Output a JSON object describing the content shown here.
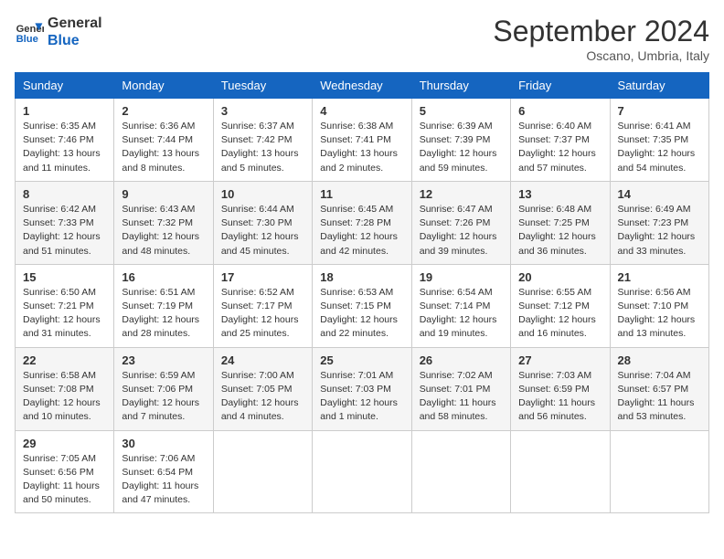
{
  "header": {
    "logo_line1": "General",
    "logo_line2": "Blue",
    "month_title": "September 2024",
    "subtitle": "Oscano, Umbria, Italy"
  },
  "days_of_week": [
    "Sunday",
    "Monday",
    "Tuesday",
    "Wednesday",
    "Thursday",
    "Friday",
    "Saturday"
  ],
  "weeks": [
    [
      {
        "day": "1",
        "sunrise": "Sunrise: 6:35 AM",
        "sunset": "Sunset: 7:46 PM",
        "daylight": "Daylight: 13 hours and 11 minutes."
      },
      {
        "day": "2",
        "sunrise": "Sunrise: 6:36 AM",
        "sunset": "Sunset: 7:44 PM",
        "daylight": "Daylight: 13 hours and 8 minutes."
      },
      {
        "day": "3",
        "sunrise": "Sunrise: 6:37 AM",
        "sunset": "Sunset: 7:42 PM",
        "daylight": "Daylight: 13 hours and 5 minutes."
      },
      {
        "day": "4",
        "sunrise": "Sunrise: 6:38 AM",
        "sunset": "Sunset: 7:41 PM",
        "daylight": "Daylight: 13 hours and 2 minutes."
      },
      {
        "day": "5",
        "sunrise": "Sunrise: 6:39 AM",
        "sunset": "Sunset: 7:39 PM",
        "daylight": "Daylight: 12 hours and 59 minutes."
      },
      {
        "day": "6",
        "sunrise": "Sunrise: 6:40 AM",
        "sunset": "Sunset: 7:37 PM",
        "daylight": "Daylight: 12 hours and 57 minutes."
      },
      {
        "day": "7",
        "sunrise": "Sunrise: 6:41 AM",
        "sunset": "Sunset: 7:35 PM",
        "daylight": "Daylight: 12 hours and 54 minutes."
      }
    ],
    [
      {
        "day": "8",
        "sunrise": "Sunrise: 6:42 AM",
        "sunset": "Sunset: 7:33 PM",
        "daylight": "Daylight: 12 hours and 51 minutes."
      },
      {
        "day": "9",
        "sunrise": "Sunrise: 6:43 AM",
        "sunset": "Sunset: 7:32 PM",
        "daylight": "Daylight: 12 hours and 48 minutes."
      },
      {
        "day": "10",
        "sunrise": "Sunrise: 6:44 AM",
        "sunset": "Sunset: 7:30 PM",
        "daylight": "Daylight: 12 hours and 45 minutes."
      },
      {
        "day": "11",
        "sunrise": "Sunrise: 6:45 AM",
        "sunset": "Sunset: 7:28 PM",
        "daylight": "Daylight: 12 hours and 42 minutes."
      },
      {
        "day": "12",
        "sunrise": "Sunrise: 6:47 AM",
        "sunset": "Sunset: 7:26 PM",
        "daylight": "Daylight: 12 hours and 39 minutes."
      },
      {
        "day": "13",
        "sunrise": "Sunrise: 6:48 AM",
        "sunset": "Sunset: 7:25 PM",
        "daylight": "Daylight: 12 hours and 36 minutes."
      },
      {
        "day": "14",
        "sunrise": "Sunrise: 6:49 AM",
        "sunset": "Sunset: 7:23 PM",
        "daylight": "Daylight: 12 hours and 33 minutes."
      }
    ],
    [
      {
        "day": "15",
        "sunrise": "Sunrise: 6:50 AM",
        "sunset": "Sunset: 7:21 PM",
        "daylight": "Daylight: 12 hours and 31 minutes."
      },
      {
        "day": "16",
        "sunrise": "Sunrise: 6:51 AM",
        "sunset": "Sunset: 7:19 PM",
        "daylight": "Daylight: 12 hours and 28 minutes."
      },
      {
        "day": "17",
        "sunrise": "Sunrise: 6:52 AM",
        "sunset": "Sunset: 7:17 PM",
        "daylight": "Daylight: 12 hours and 25 minutes."
      },
      {
        "day": "18",
        "sunrise": "Sunrise: 6:53 AM",
        "sunset": "Sunset: 7:15 PM",
        "daylight": "Daylight: 12 hours and 22 minutes."
      },
      {
        "day": "19",
        "sunrise": "Sunrise: 6:54 AM",
        "sunset": "Sunset: 7:14 PM",
        "daylight": "Daylight: 12 hours and 19 minutes."
      },
      {
        "day": "20",
        "sunrise": "Sunrise: 6:55 AM",
        "sunset": "Sunset: 7:12 PM",
        "daylight": "Daylight: 12 hours and 16 minutes."
      },
      {
        "day": "21",
        "sunrise": "Sunrise: 6:56 AM",
        "sunset": "Sunset: 7:10 PM",
        "daylight": "Daylight: 12 hours and 13 minutes."
      }
    ],
    [
      {
        "day": "22",
        "sunrise": "Sunrise: 6:58 AM",
        "sunset": "Sunset: 7:08 PM",
        "daylight": "Daylight: 12 hours and 10 minutes."
      },
      {
        "day": "23",
        "sunrise": "Sunrise: 6:59 AM",
        "sunset": "Sunset: 7:06 PM",
        "daylight": "Daylight: 12 hours and 7 minutes."
      },
      {
        "day": "24",
        "sunrise": "Sunrise: 7:00 AM",
        "sunset": "Sunset: 7:05 PM",
        "daylight": "Daylight: 12 hours and 4 minutes."
      },
      {
        "day": "25",
        "sunrise": "Sunrise: 7:01 AM",
        "sunset": "Sunset: 7:03 PM",
        "daylight": "Daylight: 12 hours and 1 minute."
      },
      {
        "day": "26",
        "sunrise": "Sunrise: 7:02 AM",
        "sunset": "Sunset: 7:01 PM",
        "daylight": "Daylight: 11 hours and 58 minutes."
      },
      {
        "day": "27",
        "sunrise": "Sunrise: 7:03 AM",
        "sunset": "Sunset: 6:59 PM",
        "daylight": "Daylight: 11 hours and 56 minutes."
      },
      {
        "day": "28",
        "sunrise": "Sunrise: 7:04 AM",
        "sunset": "Sunset: 6:57 PM",
        "daylight": "Daylight: 11 hours and 53 minutes."
      }
    ],
    [
      {
        "day": "29",
        "sunrise": "Sunrise: 7:05 AM",
        "sunset": "Sunset: 6:56 PM",
        "daylight": "Daylight: 11 hours and 50 minutes."
      },
      {
        "day": "30",
        "sunrise": "Sunrise: 7:06 AM",
        "sunset": "Sunset: 6:54 PM",
        "daylight": "Daylight: 11 hours and 47 minutes."
      },
      null,
      null,
      null,
      null,
      null
    ]
  ]
}
